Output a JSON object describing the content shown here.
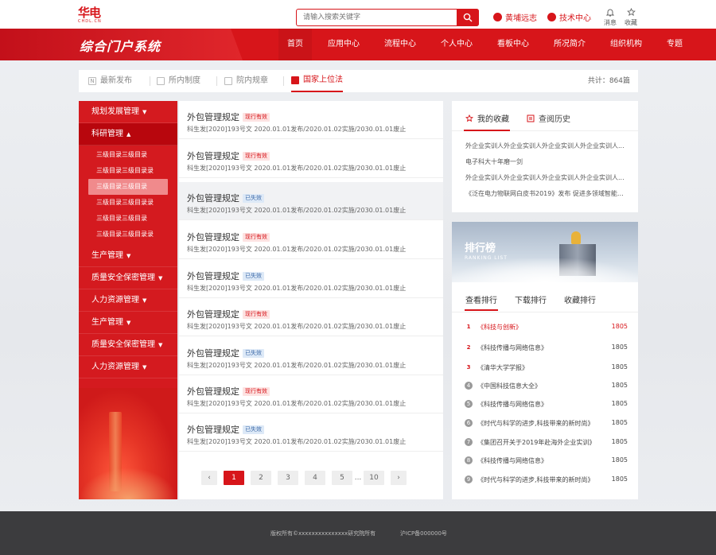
{
  "logo": {
    "mark": "华电",
    "sub": "CHDL.CN"
  },
  "search": {
    "placeholder": "请输入搜索关键字"
  },
  "top_links": [
    {
      "label": "黄埔远志",
      "icon": "user-icon"
    },
    {
      "label": "技术中心",
      "icon": "headset-icon"
    }
  ],
  "top_icons": [
    {
      "label": "消息",
      "icon": "bell-icon"
    },
    {
      "label": "收藏",
      "icon": "star-icon"
    }
  ],
  "header": {
    "title": "综合门户系统"
  },
  "nav": [
    "首页",
    "应用中心",
    "流程中心",
    "个人中心",
    "看板中心",
    "所况简介",
    "组织机构",
    "专题"
  ],
  "tabs": [
    {
      "label": "最新发布",
      "icon": "N"
    },
    {
      "label": "所内制度",
      "icon": ""
    },
    {
      "label": "院内规章",
      "icon": ""
    },
    {
      "label": "国家上位法",
      "icon": ""
    }
  ],
  "total": "共计：864篇",
  "sidebar": {
    "items": [
      {
        "label": "规划发展管理",
        "caret": "▼"
      },
      {
        "label": "科研管理",
        "caret": "▲"
      },
      {
        "label": "生产管理",
        "caret": "▼"
      },
      {
        "label": "质量安全保密管理",
        "caret": "▼"
      },
      {
        "label": "人力资源管理",
        "caret": "▼"
      },
      {
        "label": "生产管理",
        "caret": "▼"
      },
      {
        "label": "质量安全保密管理",
        "caret": "▼"
      },
      {
        "label": "人力资源管理",
        "caret": "▼"
      }
    ],
    "subitems": [
      "三级目录三级目录",
      "三级目录三级目录录",
      "三级目录三级目录",
      "三级目录三级目录录",
      "三级目录三级目录",
      "三级目录三级目录录"
    ]
  },
  "list": {
    "rows": [
      {
        "title": "外包管理规定",
        "badge": "现行有效",
        "meta": "科生发[2020]193号文 2020.01.01发布/2020.01.02实施/2030.01.01废止"
      },
      {
        "title": "外包管理规定",
        "badge": "现行有效",
        "meta": "科生发[2020]193号文 2020.01.01发布/2020.01.02实施/2030.01.01废止"
      },
      {
        "title": "外包管理规定",
        "badge": "已失效",
        "meta": "科生发[2020]193号文 2020.01.01发布/2020.01.02实施/2030.01.01废止"
      },
      {
        "title": "外包管理规定",
        "badge": "现行有效",
        "meta": "科生发[2020]193号文 2020.01.01发布/2020.01.02实施/2030.01.01废止"
      },
      {
        "title": "外包管理规定",
        "badge": "已失效",
        "meta": "科生发[2020]193号文 2020.01.01发布/2020.01.02实施/2030.01.01废止"
      },
      {
        "title": "外包管理规定",
        "badge": "现行有效",
        "meta": "科生发[2020]193号文 2020.01.01发布/2020.01.02实施/2030.01.01废止"
      },
      {
        "title": "外包管理规定",
        "badge": "已失效",
        "meta": "科生发[2020]193号文 2020.01.01发布/2020.01.02实施/2030.01.01废止"
      },
      {
        "title": "外包管理规定",
        "badge": "现行有效",
        "meta": "科生发[2020]193号文 2020.01.01发布/2020.01.02实施/2030.01.01废止"
      },
      {
        "title": "外包管理规定",
        "badge": "已失效",
        "meta": "科生发[2020]193号文 2020.01.01发布/2020.01.02实施/2030.01.01废止"
      }
    ]
  },
  "pager": {
    "prev": "‹",
    "pages": [
      "1",
      "2",
      "3",
      "4",
      "5"
    ],
    "dots": "...",
    "last": "10",
    "next": "›"
  },
  "favorites": {
    "tab_fav": "我的收藏",
    "tab_hist": "查阅历史",
    "items": [
      "外企业实训人外企业实训人外企业实训人外企业实训人...",
      "电子科大十年磨一剑",
      "外企业实训人外企业实训人外企业实训人外企业实训人...",
      "《泛在电力物联网白皮书2019》发布 促进多领域智能升..."
    ]
  },
  "ranking": {
    "title": "排行榜",
    "subtitle": "RANKING LIST",
    "tabs": [
      "查看排行",
      "下载排行",
      "收藏排行"
    ],
    "rows": [
      {
        "rank": "1",
        "name": "《科技与创新》",
        "count": "1805"
      },
      {
        "rank": "2",
        "name": "《科技传播与网络信息》",
        "count": "1805"
      },
      {
        "rank": "3",
        "name": "《清华大学学报》",
        "count": "1805"
      },
      {
        "rank": "4",
        "name": "《中国科技信息大全》",
        "count": "1805"
      },
      {
        "rank": "5",
        "name": "《科技传播与网络信息》",
        "count": "1805"
      },
      {
        "rank": "6",
        "name": "《时代与科学的进步,科技带来的新时尚》",
        "count": "1805"
      },
      {
        "rank": "7",
        "name": "《集团召开关于2019年赴海外企业实训》",
        "count": "1805"
      },
      {
        "rank": "8",
        "name": "《科技传播与网络信息》",
        "count": "1805"
      },
      {
        "rank": "9",
        "name": "《时代与科学的进步,科技带来的新时尚》",
        "count": "1805"
      }
    ]
  },
  "footer": {
    "copyright": "版权所有©xxxxxxxxxxxxxxx研究院所有",
    "icp": "沪ICP备000000号"
  },
  "colors": {
    "brand": "#d7151a",
    "footer": "#3c3c3e"
  }
}
